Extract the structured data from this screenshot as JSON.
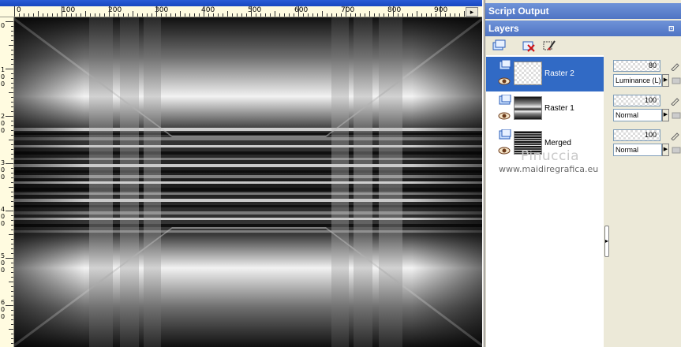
{
  "ruler": {
    "top_labels": [
      "0",
      "100",
      "200",
      "300",
      "400",
      "500",
      "600",
      "700",
      "800",
      "900"
    ],
    "left_labels": [
      "0",
      "100",
      "200",
      "300",
      "400",
      "500",
      "600"
    ]
  },
  "palettes": {
    "script_output_title": "Script Output",
    "layers_title": "Layers"
  },
  "toolbar": {
    "icons": [
      "new-raster-layer-icon",
      "delete-layer-icon",
      "edit-brush-icon"
    ]
  },
  "layers": [
    {
      "name": "Raster 2",
      "opacity": "80",
      "blend": "Luminance (L)",
      "selected": true,
      "thumb": "checker"
    },
    {
      "name": "Raster 1",
      "opacity": "100",
      "blend": "Normal",
      "selected": false,
      "thumb": "image"
    },
    {
      "name": "Merged",
      "opacity": "100",
      "blend": "Normal",
      "selected": false,
      "thumb": "stripes"
    }
  ],
  "watermark": {
    "name": "Pinuccia",
    "site": "www.maidiregrafica.eu"
  },
  "colors": {
    "title_bar": "#4f74c4",
    "selection": "#316ac5",
    "ruler_bg": "#fffbe0",
    "panel_bg": "#ece9d8"
  }
}
